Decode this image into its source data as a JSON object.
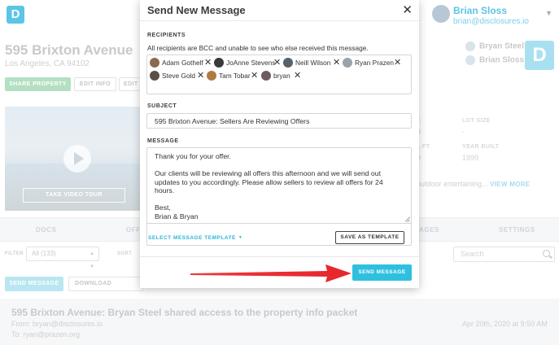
{
  "app": {
    "logo": "D"
  },
  "user": {
    "name": "Brian Sloss",
    "email": "brian@disclosures.io"
  },
  "property": {
    "title": "595 Brixton Avenue",
    "address": "Los Angeles, CA 94102",
    "share_label": "SHARE PROPERTY",
    "edit_info_label": "EDIT INFO",
    "edit_label_partial": "EDIT",
    "video_label": "TAKE VIDEO TOUR",
    "agents": [
      "Bryan Steel",
      "Brian Sloss"
    ],
    "brand_logo": "D",
    "specs": {
      "lot_size_label": "LOT SIZE",
      "lot_size_value": "-",
      "year_built_label": "YEAR BUILT",
      "year_built_value": "1999",
      "partial_label_1": "T.",
      "partial_value_1": "0",
      "partial_label_2": "., FT.",
      "partial_value_2": "9"
    },
    "description_fragment": "outdoor entertaining...",
    "view_more": "VIEW MORE"
  },
  "tabs": {
    "docs": "DOCS",
    "offers_partial": "OFF",
    "messages_partial": "AGES",
    "settings": "SETTINGS"
  },
  "filters": {
    "filter_label": "FILTER",
    "filter_value": "All (133)",
    "sort_label": "SORT",
    "search_placeholder": "Search"
  },
  "actions": {
    "send_message": "SEND MESSAGE",
    "download_messages": "DOWNLOAD MESSAGES"
  },
  "message_row": {
    "subject": "595 Brixton Avenue: Bryan Steel shared access to the property info packet",
    "from": "From: bryan@disclosures.io",
    "to": "To: ryan@prazen.org",
    "date": "Apr 20th, 2020 at 9:50 AM"
  },
  "modal": {
    "title": "Send New Message",
    "recipients_label": "RECIPIENTS",
    "recipients_help": "All recipients are BCC and unable to see who else received this message.",
    "recipients": [
      {
        "name": "Adam Gothelf",
        "avatar_color": "#8a6b52"
      },
      {
        "name": "JoAnne Stevens",
        "avatar_color": "#3a3a3a"
      },
      {
        "name": "Neill Wilson",
        "avatar_color": "#55616b"
      },
      {
        "name": "Ryan Prazen",
        "avatar_color": "#9aa3aa"
      },
      {
        "name": "Steve Gold",
        "avatar_color": "#5a5048"
      },
      {
        "name": "Tam Tobar",
        "avatar_color": "#b07a45"
      },
      {
        "name": "bryan",
        "avatar_color": "#6e5a63"
      }
    ],
    "subject_label": "SUBJECT",
    "subject_value": "595 Brixton Avenue: Sellers Are Reviewing Offers",
    "message_label": "MESSAGE",
    "message_value": "Thank you for your offer.\n\nOur clients will be reviewing all offers this afternoon and we will send out updates to you accordingly. Please allow sellers to review all offers for 24 hours.\n\nBest,\nBrian & Bryan",
    "select_template": "SELECT MESSAGE TEMPLATE",
    "save_template": "SAVE AS TEMPLATE",
    "send_button": "SEND MESSAGE"
  },
  "colors": {
    "accent": "#2fc0e0",
    "annotation_arrow": "#e8242a"
  }
}
